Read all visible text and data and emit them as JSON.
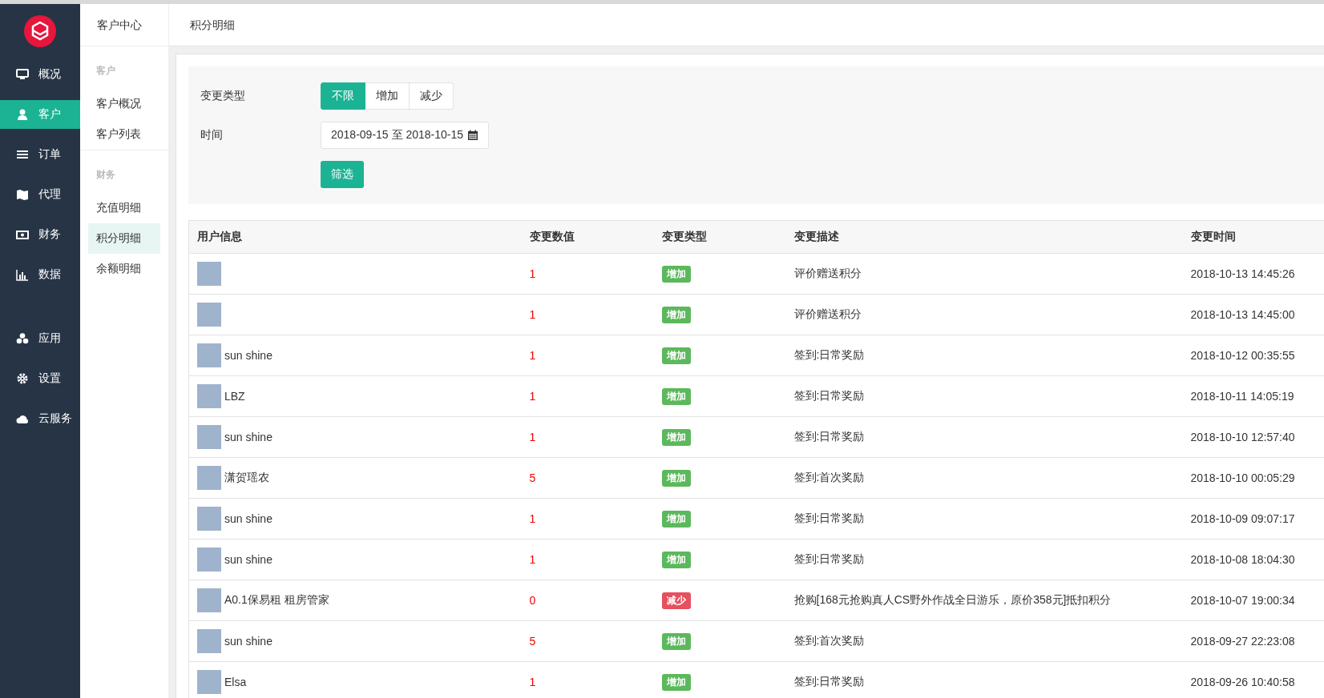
{
  "main_nav": {
    "items": [
      {
        "label": "概况",
        "selected": false
      },
      {
        "label": "客户",
        "selected": true
      },
      {
        "label": "订单",
        "selected": false
      },
      {
        "label": "代理",
        "selected": false
      },
      {
        "label": "财务",
        "selected": false
      },
      {
        "label": "数据",
        "selected": false
      },
      {
        "label": "应用",
        "selected": false
      },
      {
        "label": "设置",
        "selected": false
      },
      {
        "label": "云服务",
        "selected": false
      }
    ]
  },
  "sub_nav": {
    "title": "客户中心",
    "sections": [
      {
        "heading": "客户",
        "items": [
          {
            "label": "客户概况",
            "selected": false
          },
          {
            "label": "客户列表",
            "selected": false
          }
        ]
      },
      {
        "heading": "财务",
        "items": [
          {
            "label": "充值明细",
            "selected": false
          },
          {
            "label": "积分明细",
            "selected": true
          },
          {
            "label": "余额明细",
            "selected": false
          }
        ]
      }
    ]
  },
  "page_title": "积分明细",
  "filter": {
    "type_label": "变更类型",
    "type_options": [
      {
        "label": "不限",
        "selected": true
      },
      {
        "label": "增加",
        "selected": false
      },
      {
        "label": "减少",
        "selected": false
      }
    ],
    "time_label": "时间",
    "time_value": "2018-09-15 至 2018-10-15",
    "submit": "筛选"
  },
  "table": {
    "columns": [
      "用户信息",
      "变更数值",
      "变更类型",
      "变更描述",
      "变更时间"
    ],
    "rows": [
      {
        "user": "",
        "value": "1",
        "kind": "increase",
        "type": "增加",
        "description": "评价赠送积分",
        "time": "2018-10-13 14:45:26"
      },
      {
        "user": "",
        "value": "1",
        "kind": "increase",
        "type": "增加",
        "description": "评价赠送积分",
        "time": "2018-10-13 14:45:00"
      },
      {
        "user": "sun shine",
        "value": "1",
        "kind": "increase",
        "type": "增加",
        "description": "签到:日常奖励",
        "time": "2018-10-12 00:35:55"
      },
      {
        "user": "LBZ",
        "value": "1",
        "kind": "increase",
        "type": "增加",
        "description": "签到:日常奖励",
        "time": "2018-10-11 14:05:19"
      },
      {
        "user": "sun shine",
        "value": "1",
        "kind": "increase",
        "type": "增加",
        "description": "签到:日常奖励",
        "time": "2018-10-10 12:57:40"
      },
      {
        "user": "潇贺瑶农",
        "value": "5",
        "kind": "increase",
        "type": "增加",
        "description": "签到:首次奖励",
        "time": "2018-10-10 00:05:29"
      },
      {
        "user": "sun shine",
        "value": "1",
        "kind": "increase",
        "type": "增加",
        "description": "签到:日常奖励",
        "time": "2018-10-09 09:07:17"
      },
      {
        "user": "sun shine",
        "value": "1",
        "kind": "increase",
        "type": "增加",
        "description": "签到:日常奖励",
        "time": "2018-10-08 18:04:30"
      },
      {
        "user": "A0.1保易租 租房管家",
        "value": "0",
        "kind": "decrease",
        "type": "减少",
        "description": "抢购[168元抢购真人CS野外作战全日游乐，原价358元]抵扣积分",
        "time": "2018-10-07 19:00:34"
      },
      {
        "user": "sun shine",
        "value": "5",
        "kind": "increase",
        "type": "增加",
        "description": "签到:首次奖励",
        "time": "2018-09-27 22:23:08"
      },
      {
        "user": "Elsa",
        "value": "1",
        "kind": "increase",
        "type": "增加",
        "description": "签到:日常奖励",
        "time": "2018-09-26 10:40:58"
      }
    ]
  }
}
